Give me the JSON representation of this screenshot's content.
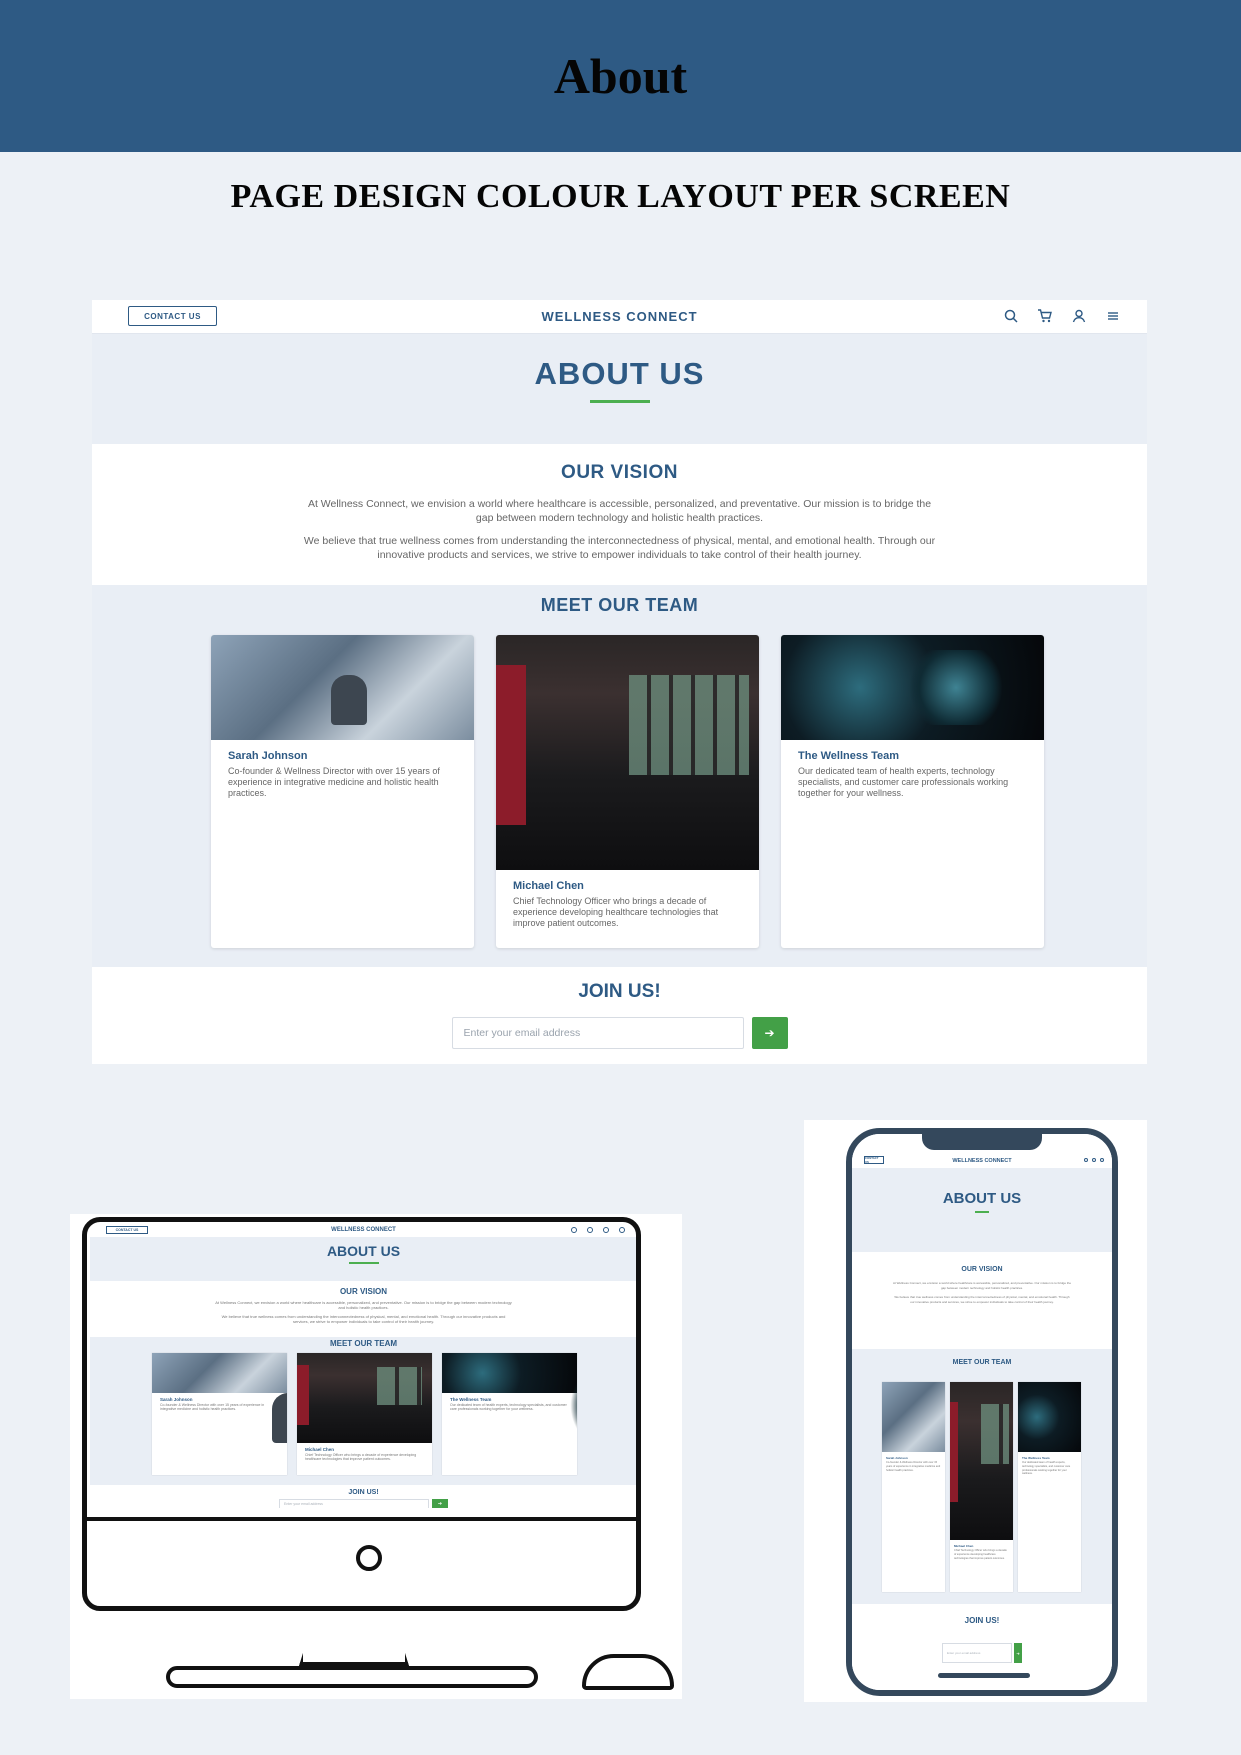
{
  "page": {
    "title": "About",
    "subtitle": "PAGE DESIGN COLOUR LAYOUT PER SCREEN"
  },
  "colors": {
    "banner": "#2e5a84",
    "brand_blue": "#2e5a84",
    "accent_green": "#4caf50",
    "page_bg": "#edf1f6"
  },
  "site": {
    "contact_label": "CONTACT US",
    "brand": "WELLNESS CONNECT",
    "nav_icons": [
      "search-icon",
      "cart-icon",
      "user-icon",
      "menu-icon"
    ],
    "heading": "ABOUT US",
    "vision": {
      "title": "OUR VISION",
      "p1": "At Wellness Connect, we envision a world where healthcare is accessible, personalized, and preventative. Our mission is to bridge the gap between modern technology and holistic health practices.",
      "p2": "We believe that true wellness comes from understanding the interconnectedness of physical, mental, and emotional health. Through our innovative products and services, we strive to empower individuals to take control of their health journey."
    },
    "team": {
      "title": "MEET OUR TEAM",
      "members": [
        {
          "name": "Sarah Johnson",
          "desc": "Co-founder & Wellness Director with over 15 years of experience in integrative medicine and holistic health practices."
        },
        {
          "name": "Michael Chen",
          "desc": "Chief Technology Officer who brings a decade of experience developing healthcare technologies that improve patient outcomes."
        },
        {
          "name": "The Wellness Team",
          "desc": "Our dedicated team of health experts, technology specialists, and customer care professionals working together for your wellness."
        }
      ]
    },
    "join": {
      "title": "JOIN US!",
      "placeholder": "Enter your email address",
      "submit_icon": "arrow-right-icon",
      "submit_glyph": "➔"
    }
  },
  "mobile": {
    "contact_label": "CONTACT US",
    "brand": "WELLNESS CONNECT",
    "heading": "ABOUT US",
    "vision_title": "OUR VISION",
    "team_title": "MEET OUR TEAM",
    "join_title": "JOIN US!",
    "placeholder": "Enter your email address"
  }
}
